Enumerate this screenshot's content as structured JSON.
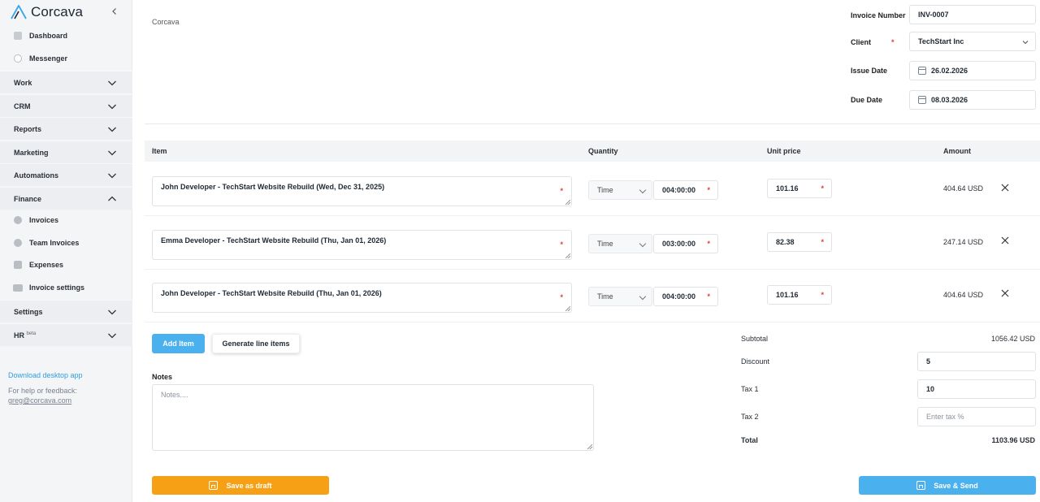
{
  "sidebar": {
    "brand": "Corcava",
    "items": [
      {
        "label": "Dashboard",
        "icon": "dashboard-icon"
      },
      {
        "label": "Messenger",
        "icon": "messenger-icon"
      }
    ],
    "groups": [
      {
        "label": "Work"
      },
      {
        "label": "CRM"
      },
      {
        "label": "Reports"
      },
      {
        "label": "Marketing"
      },
      {
        "label": "Automations"
      },
      {
        "label": "Finance",
        "expanded": true
      },
      {
        "label": "Settings"
      },
      {
        "label": "HR",
        "badge": "beta"
      }
    ],
    "finance_items": [
      {
        "label": "Invoices",
        "icon": "dollar-icon"
      },
      {
        "label": "Team Invoices",
        "icon": "dollar-icon"
      },
      {
        "label": "Expenses",
        "icon": "receipt-icon"
      },
      {
        "label": "Invoice settings",
        "icon": "wallet-icon"
      }
    ],
    "download_link": "Download desktop app",
    "help_text": "For help or feedback:",
    "help_email": "greg@corcava.com"
  },
  "header": {
    "breadcrumb": "Corcava",
    "invoice_number_label": "Invoice Number",
    "invoice_number": "INV-0007",
    "client_label": "Client",
    "client": "TechStart Inc",
    "issue_date_label": "Issue Date",
    "issue_date": "26.02.2026",
    "due_date_label": "Due Date",
    "due_date": "08.03.2026"
  },
  "table": {
    "columns": [
      "Item",
      "Quantity",
      "Unit price",
      "Amount"
    ],
    "rows": [
      {
        "description": "John Developer - TechStart Website Rebuild (Wed, Dec 31, 2025)",
        "unit": "Time",
        "quantity": "004:00:00",
        "unit_price": "101.16",
        "amount": "404.64 USD"
      },
      {
        "description": "Emma Developer - TechStart Website Rebuild (Thu, Jan 01, 2026)",
        "unit": "Time",
        "quantity": "003:00:00",
        "unit_price": "82.38",
        "amount": "247.14 USD"
      },
      {
        "description": "John Developer - TechStart Website Rebuild (Thu, Jan 01, 2026)",
        "unit": "Time",
        "quantity": "004:00:00",
        "unit_price": "101.16",
        "amount": "404.64 USD"
      }
    ]
  },
  "actions": {
    "add_item": "Add Item",
    "generate": "Generate line items",
    "save_draft": "Save as draft",
    "save_send": "Save & Send"
  },
  "notes": {
    "label": "Notes",
    "placeholder": "Notes...."
  },
  "totals": {
    "subtotal_label": "Subtotal",
    "subtotal": "1056.42 USD",
    "discount_label": "Discount",
    "discount": "5",
    "tax1_label": "Tax 1",
    "tax1": "10",
    "tax2_label": "Tax 2",
    "tax2_placeholder": "Enter tax %",
    "total_label": "Total",
    "total": "1103.96 USD"
  },
  "colors": {
    "accent_blue": "#4ab0ee",
    "draft_orange": "#f5a015",
    "required_red": "#e23b3b"
  }
}
